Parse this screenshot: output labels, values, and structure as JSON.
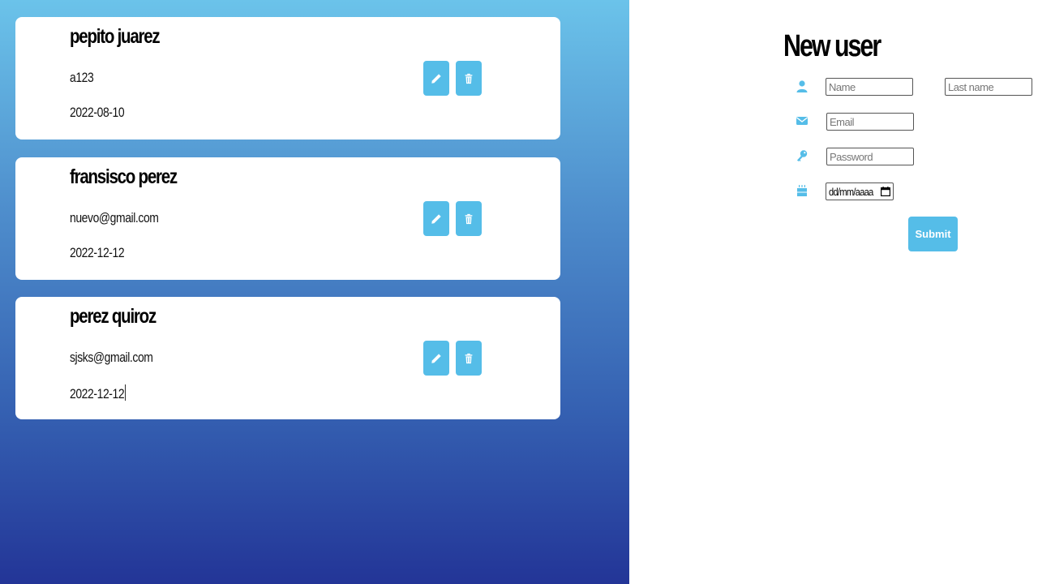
{
  "users": [
    {
      "name": "pepito juarez",
      "sub": "a123",
      "date": "2022-08-10"
    },
    {
      "name": "fransisco perez",
      "sub": "nuevo@gmail.com",
      "date": "2022-12-12"
    },
    {
      "name": "perez quiroz",
      "sub": "sjsks@gmail.com",
      "date": "2022-12-12"
    }
  ],
  "form": {
    "title": "New user",
    "name_placeholder": "Name",
    "lastname_placeholder": "Last name",
    "email_placeholder": "Email",
    "password_placeholder": "Password",
    "date_value": "dd/mm/aaaa",
    "submit_label": "Submit"
  },
  "icons": {
    "edit": "pencil-icon",
    "delete": "trash-icon",
    "name": "user-icon",
    "email": "envelope-icon",
    "password": "key-icon",
    "birthday": "cake-icon",
    "date": "calendar-icon"
  },
  "colors": {
    "accent": "#55bde8",
    "gradient_top": "#6bc3ea",
    "gradient_bottom": "#233597"
  }
}
